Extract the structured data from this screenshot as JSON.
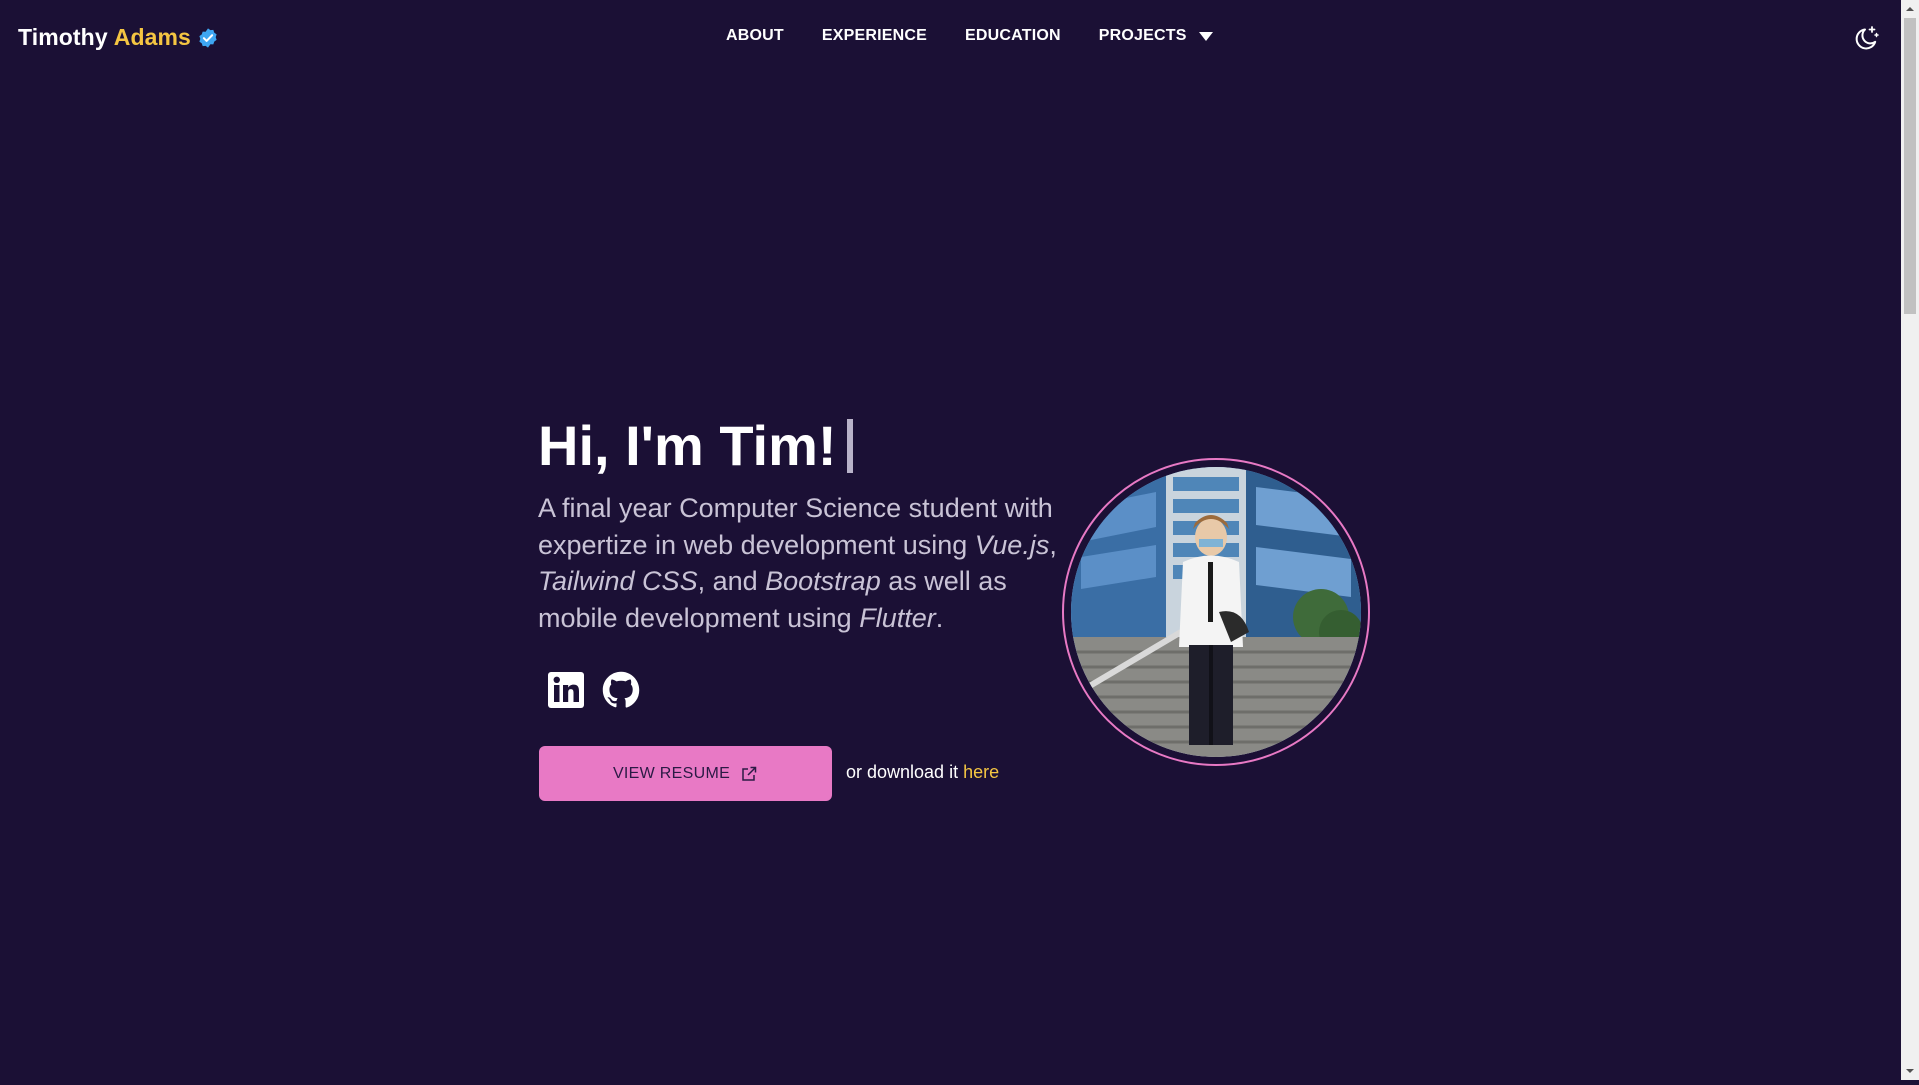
{
  "nav": {
    "brand_first": "Timothy",
    "brand_last": "Adams",
    "links": {
      "about": "ABOUT",
      "experience": "EXPERIENCE",
      "education": "EDUCATION",
      "projects": "PROJECTS"
    }
  },
  "hero": {
    "title": "Hi, I'm Tim!",
    "desc_1": "A final year Computer Science student with expertize in web development using ",
    "tech_vue": "Vue.js",
    "sep_1": ", ",
    "tech_tailwind": "Tailwind CSS",
    "sep_2": ", and ",
    "tech_bootstrap": "Bootstrap",
    "desc_2": " as well as mobile development using ",
    "tech_flutter": "Flutter",
    "desc_end": ".",
    "resume_label": "VIEW RESUME",
    "download_prefix": "or download it ",
    "download_link": "here"
  },
  "icons": {
    "verified": "verified-badge-icon",
    "theme": "moon-stars-icon",
    "linkedin": "linkedin-icon",
    "github": "github-icon",
    "external": "external-link-icon"
  },
  "colors": {
    "background": "#1b1035",
    "accent_yellow": "#f4c542",
    "accent_pink": "#e879c5",
    "verified_blue": "#3ea6f2"
  }
}
